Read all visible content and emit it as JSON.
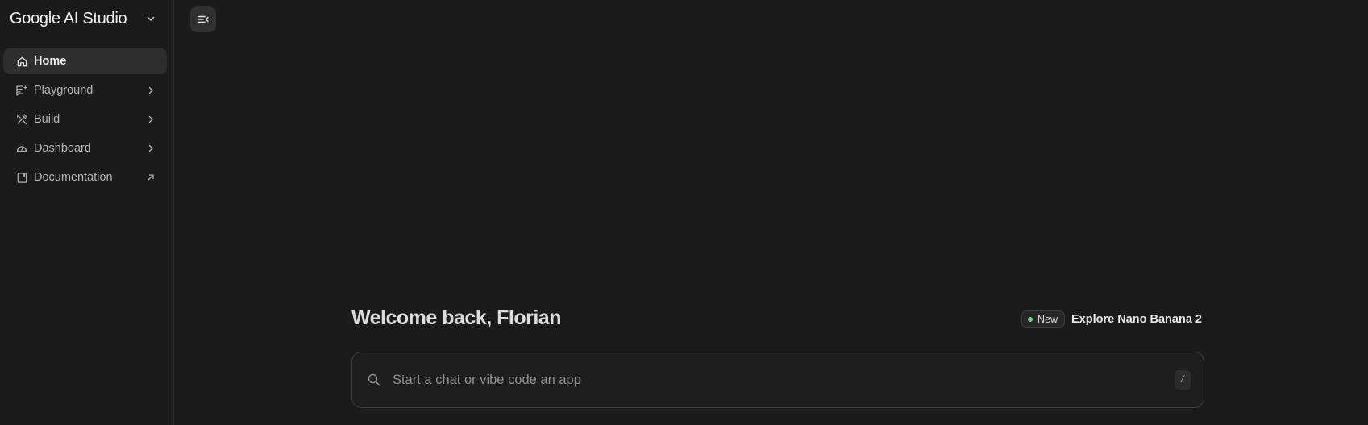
{
  "brand": {
    "name": "Google AI Studio",
    "icon": "chevron-down-icon"
  },
  "nav": {
    "items": [
      {
        "label": "Home",
        "icon": "home-icon",
        "trail": "",
        "active": true
      },
      {
        "label": "Playground",
        "icon": "playground-icon",
        "trail": "chevron-right-icon",
        "active": false
      },
      {
        "label": "Build",
        "icon": "build-icon",
        "trail": "chevron-right-icon",
        "active": false
      },
      {
        "label": "Dashboard",
        "icon": "dashboard-icon",
        "trail": "chevron-right-icon",
        "active": false
      },
      {
        "label": "Documentation",
        "icon": "book-icon",
        "trail": "external-link-icon",
        "active": false
      }
    ]
  },
  "toolbar": {
    "collapse_icon": "collapse-sidebar-icon"
  },
  "main": {
    "welcome": "Welcome back, Florian",
    "badge": "New",
    "explore": "Explore Nano Banana 2",
    "search": {
      "placeholder": "Start a chat or vibe code an app",
      "value": "",
      "shortcut": "/"
    }
  },
  "colors": {
    "background": "#1b1b1b",
    "active_item": "#2e2e2e",
    "badge_dot": "#6dd58c"
  }
}
